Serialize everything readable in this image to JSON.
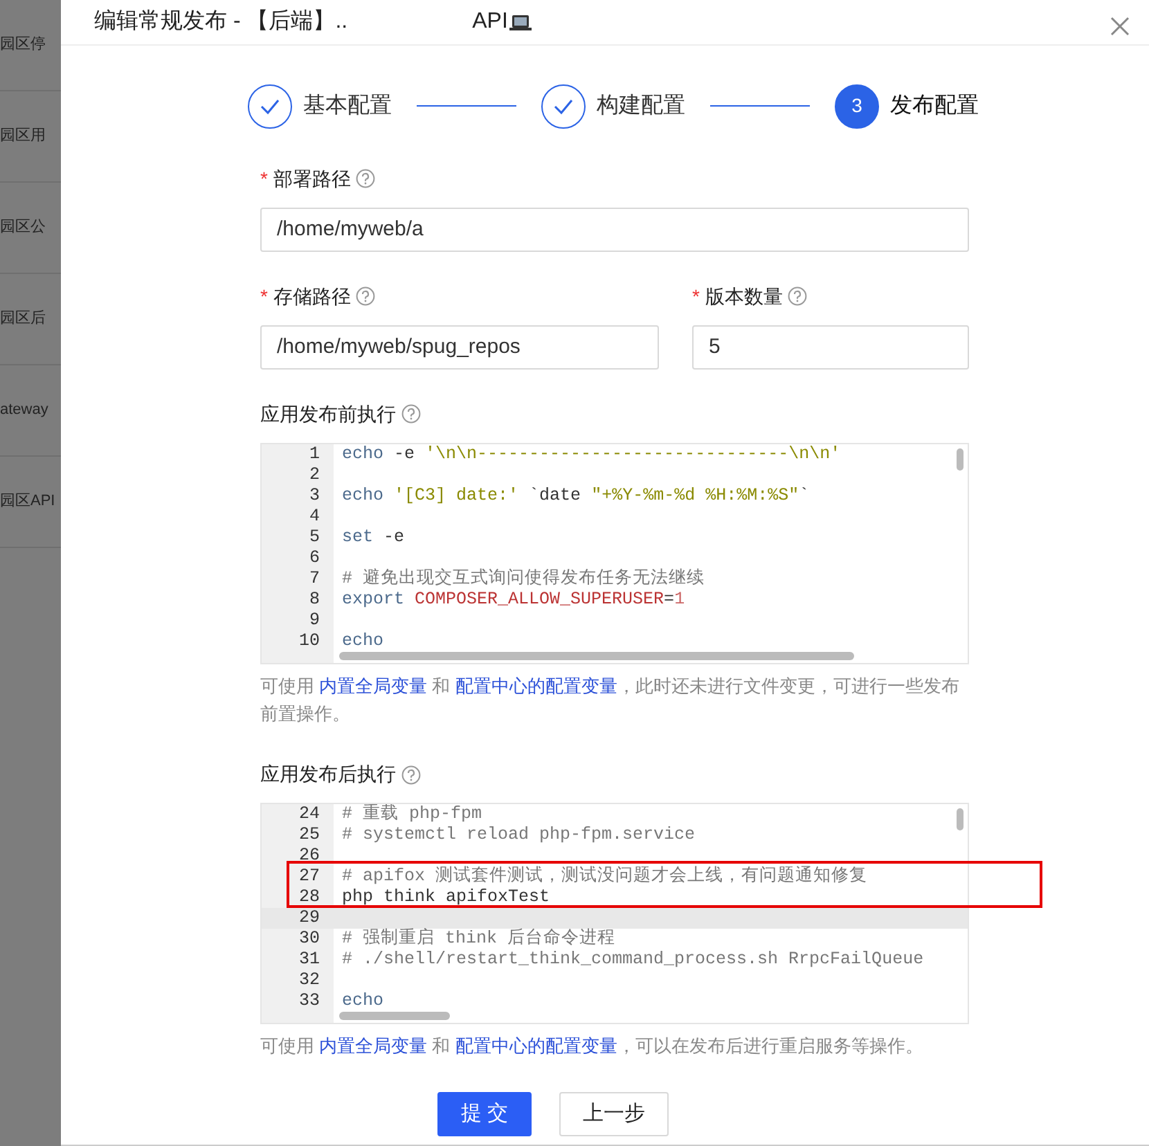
{
  "background_sidebar": {
    "items": [
      "园区停",
      "园区用",
      "园区公",
      "园区后",
      "ateway",
      "园区API"
    ]
  },
  "modal": {
    "title": "编辑常规发布 - 【后端】..",
    "title_suffix": "API",
    "steps": [
      {
        "label": "基本配置",
        "done": true,
        "selected": false
      },
      {
        "label": "构建配置",
        "done": true,
        "selected": false
      },
      {
        "label": "发布配置",
        "done": false,
        "selected": true,
        "number": "3"
      }
    ],
    "fields": [
      {
        "label": "部署路径",
        "required_mark": "*",
        "value": "/home/myweb/a"
      },
      {
        "label": "存储路径",
        "required_mark": "*",
        "value": "/home/myweb/spug_repos"
      },
      {
        "label": "版本数量",
        "required_mark": "*",
        "value": "5"
      }
    ],
    "editors": [
      {
        "label": "应用发布前执行",
        "lines": [
          {
            "n": "1",
            "segs": [
              {
                "kind": "cmd",
                "text": "echo"
              },
              {
                "kind": "plain",
                "text": " -e "
              },
              {
                "kind": "str",
                "text": "'\\n\\n------------------------------\\n\\n'"
              }
            ]
          },
          {
            "n": "2"
          },
          {
            "n": "3",
            "segs": [
              {
                "kind": "cmd",
                "text": "echo"
              },
              {
                "kind": "str",
                "text": " '[C3] date:'"
              },
              {
                "kind": "plain",
                "text": " `date "
              },
              {
                "kind": "str",
                "text": "\"+%Y-%m-%d %H:%M:%S\""
              },
              {
                "kind": "plain",
                "text": "`"
              }
            ]
          },
          {
            "n": "4"
          },
          {
            "n": "5",
            "segs": [
              {
                "kind": "cmd",
                "text": "set"
              },
              {
                "kind": "plain",
                "text": " -e"
              }
            ]
          },
          {
            "n": "6"
          },
          {
            "n": "7",
            "segs": [
              {
                "kind": "comment",
                "text": "# 避免出现交互式询问使得发布任务无法继续"
              }
            ]
          },
          {
            "n": "8",
            "segs": [
              {
                "kind": "cmd",
                "text": "export"
              },
              {
                "kind": "var",
                "text": " COMPOSER_ALLOW_SUPERUSER"
              },
              {
                "kind": "plain",
                "text": "="
              },
              {
                "kind": "num",
                "text": "1"
              }
            ]
          },
          {
            "n": "9"
          },
          {
            "n": "10",
            "segs": [
              {
                "kind": "cmd",
                "text": "echo"
              }
            ]
          }
        ],
        "help": [
          {
            "text": "可使用 ",
            "link": false
          },
          {
            "text": "内置全局变量",
            "link": true
          },
          {
            "text": " 和 ",
            "link": false
          },
          {
            "text": "配置中心的配置变量",
            "link": true
          },
          {
            "text": "，此时还未进行文件变更，可进行一些发布前置操作。",
            "link": false
          }
        ]
      },
      {
        "label": "应用发布后执行",
        "lines": [
          {
            "n": "24",
            "segs": [
              {
                "kind": "comment",
                "text": "# 重载 php-fpm"
              }
            ]
          },
          {
            "n": "25",
            "segs": [
              {
                "kind": "comment",
                "text": "# systemctl reload php-fpm.service"
              }
            ]
          },
          {
            "n": "26"
          },
          {
            "n": "27",
            "segs": [
              {
                "kind": "comment",
                "text": "# apifox 测试套件测试，测试没问题才会上线，有问题通知修复"
              }
            ]
          },
          {
            "n": "28",
            "segs": [
              {
                "kind": "plain",
                "text": "php think apifoxTest"
              }
            ]
          },
          {
            "n": "29",
            "active": true
          },
          {
            "n": "30",
            "segs": [
              {
                "kind": "comment",
                "text": "# 强制重启 think 后台命令进程"
              }
            ]
          },
          {
            "n": "31",
            "segs": [
              {
                "kind": "comment",
                "text": "# ./shell/restart_think_command_process.sh RrpcFailQueue"
              }
            ]
          },
          {
            "n": "32"
          },
          {
            "n": "33",
            "segs": [
              {
                "kind": "cmd",
                "text": "echo"
              }
            ]
          }
        ],
        "help": [
          {
            "text": "可使用 ",
            "link": false
          },
          {
            "text": "内置全局变量",
            "link": true
          },
          {
            "text": " 和 ",
            "link": false
          },
          {
            "text": "配置中心的配置变量",
            "link": true
          },
          {
            "text": "，可以在发布后进行重启服务等操作。",
            "link": false
          }
        ]
      }
    ],
    "buttons": [
      {
        "label": "提 交",
        "kind": "primary"
      },
      {
        "label": "上一步",
        "kind": "default"
      }
    ]
  }
}
